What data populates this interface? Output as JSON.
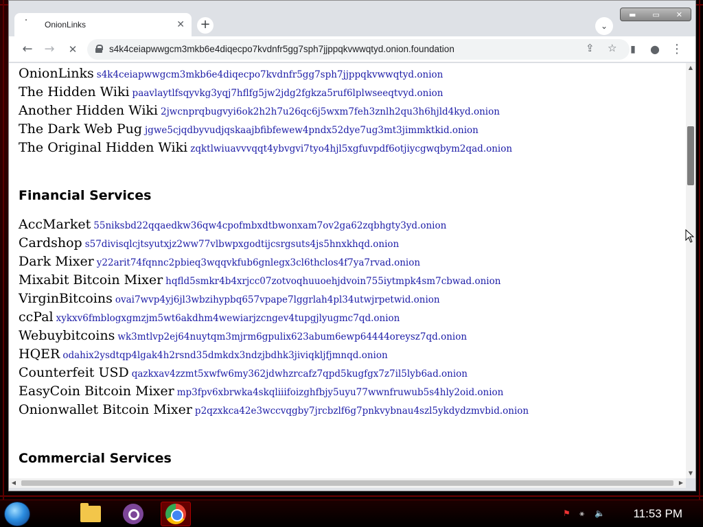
{
  "browser": {
    "tab_title": "OnionLinks",
    "tab_close": "✕",
    "new_tab": "+",
    "tab_search": "⌄",
    "url": "s4k4ceiapwwgcm3mkb6e4diqecpo7kvdnfr5gg7sph7jjppqkvwwqtyd.onion.foundation",
    "back": "←",
    "forward": "→",
    "reload": "✕",
    "share_icon": "⇪",
    "star_icon": "☆",
    "sidepanel_icon": "▮",
    "profile_icon": "●",
    "menu_icon": "⋮",
    "win_min": "▬",
    "win_max": "▭",
    "win_close": "✕"
  },
  "links_top": [
    {
      "name": "OnionLinks",
      "url": "s4k4ceiapwwgcm3mkb6e4diqecpo7kvdnfr5gg7sph7jjppqkvwwqtyd.onion"
    },
    {
      "name": "The Hidden Wiki",
      "url": "paavlaytlfsqyvkg3yqj7hflfg5jw2jdg2fgkza5ruf6lplwseeqtvyd.onion"
    },
    {
      "name": "Another Hidden Wiki",
      "url": "2jwcnprqbugvyi6ok2h2h7u26qc6j5wxm7feh3znlh2qu3h6hjld4kyd.onion"
    },
    {
      "name": "The Dark Web Pug",
      "url": "jgwe5cjqdbyvudjqskaajbfibfewew4pndx52dye7ug3mt3jimmktkid.onion"
    },
    {
      "name": "The Original Hidden Wiki",
      "url": "zqktlwiuavvvqqt4ybvgvi7tyo4hjl5xgfuvpdf6otjiycgwqbym2qad.onion"
    }
  ],
  "financial_heading": "Financial Services",
  "financial_links": [
    {
      "name": "AccMarket",
      "url": "55niksbd22qqaedkw36qw4cpofmbxdtbwonxam7ov2ga62zqbhgty3yd.onion"
    },
    {
      "name": "Cardshop",
      "url": "s57divisqlcjtsyutxjz2ww77vlbwpxgodtijcsrgsuts4js5hnxkhqd.onion"
    },
    {
      "name": "Dark Mixer",
      "url": "y22arit74fqnnc2pbieq3wqqvkfub6gnlegx3cl6thclos4f7ya7rvad.onion"
    },
    {
      "name": "Mixabit Bitcoin Mixer",
      "url": "hqfld5smkr4b4xrjcc07zotvoqhuuoehjdvoin755iytmpk4sm7cbwad.onion"
    },
    {
      "name": "VirginBitcoins",
      "url": "ovai7wvp4yj6jl3wbzihypbq657vpape7lggrlah4pl34utwjrpetwid.onion"
    },
    {
      "name": "ccPal",
      "url": "xykxv6fmblogxgmzjm5wt6akdhm4wewiarjzcngev4tupgjlyugmc7qd.onion"
    },
    {
      "name": "Webuybitcoins",
      "url": "wk3mtlvp2ej64nuytqm3mjrm6gpulix623abum6ewp64444oreysz7qd.onion"
    },
    {
      "name": "HQER",
      "url": "odahix2ysdtqp4lgak4h2rsnd35dmkdx3ndzjbdhk3jiviqkljfjmnqd.onion"
    },
    {
      "name": "Counterfeit USD",
      "url": "qazkxav4zzmt5xwfw6my362jdwhzrcafz7qpd5kugfgx7z7il5lyb6ad.onion"
    },
    {
      "name": "EasyCoin Bitcoin Mixer",
      "url": "mp3fpv6xbrwka4skqliiifoizghfbjy5uyu77wwnfruwub5s4hly2oid.onion"
    },
    {
      "name": "Onionwallet Bitcoin Mixer",
      "url": "p2qzxkca42e3wccvqgby7jrcbzlf6g7pnkvybnau4szl5ykdydzmvbid.onion"
    }
  ],
  "commercial_heading": "Commercial Services",
  "taskbar": {
    "clock": "11:53 PM",
    "tray_flag": "⚑",
    "tray_network": "⚹",
    "tray_volume": "🔈"
  }
}
